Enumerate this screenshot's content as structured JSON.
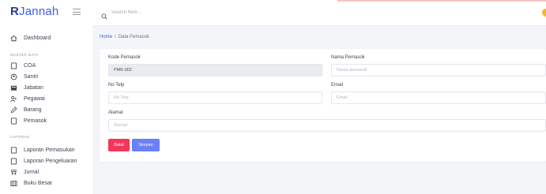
{
  "app": {
    "brand_initial": "R",
    "brand_rest": "Jannah"
  },
  "search": {
    "placeholder": "Search here..."
  },
  "sidebar": {
    "dashboard": "Dashboard",
    "master_data_label": "MASTER DATA",
    "master_items": [
      "COA",
      "Santri",
      "Jabatan",
      "Pegawai",
      "Barang",
      "Pemasok"
    ],
    "laporan_label": "LAPORAN",
    "laporan_items": [
      "Laporan Pemasukan",
      "Laporan Pengeluaran",
      "Jurnal",
      "Buku Besar"
    ]
  },
  "breadcrumb": {
    "home": "Home",
    "separator": "/",
    "current": "Data Pemasok"
  },
  "form": {
    "kode_label": "Kode Pemasok",
    "kode_value": "PMK-002",
    "nama_label": "Nama Pemasok",
    "nama_placeholder": "Nama pemasok",
    "telp_label": "No Telp",
    "telp_placeholder": "No Telp",
    "email_label": "Email",
    "email_placeholder": "Email",
    "alamat_label": "Alamat",
    "alamat_placeholder": "Alamat",
    "batal_label": "Batal",
    "simpan_label": "Simpan"
  },
  "colors": {
    "primary": "#3d5ce8",
    "danger": "#f5365c",
    "accent": "#6b7ff6",
    "avatar": "#f2b631"
  },
  "icons": {
    "dashboard": "home-icon",
    "coa": "document-icon",
    "santri": "user-circle-icon",
    "jabatan": "card-icon",
    "pegawai": "users-icon",
    "barang": "pen-icon",
    "pemasok": "document-icon",
    "laporan_pemasukan": "document-icon",
    "laporan_pengeluaran": "document-icon",
    "jurnal": "ledger-icon",
    "buku_besar": "book-icon"
  }
}
